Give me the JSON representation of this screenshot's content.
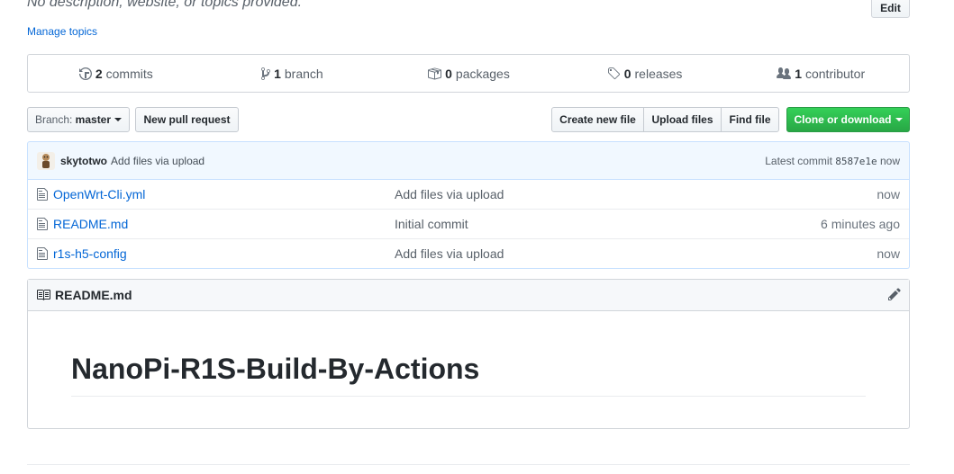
{
  "repo": {
    "description": "No description, website, or topics provided.",
    "edit_label": "Edit",
    "manage_topics": "Manage topics"
  },
  "summary": {
    "commits_count": "2",
    "commits_label": "commits",
    "branch_count": "1",
    "branch_label": "branch",
    "packages_count": "0",
    "packages_label": "packages",
    "releases_count": "0",
    "releases_label": "releases",
    "contributor_count": "1",
    "contributor_label": "contributor"
  },
  "toolbar": {
    "branch_prefix": "Branch:",
    "branch_name": "master",
    "new_pull_request": "New pull request",
    "create_new_file": "Create new file",
    "upload_files": "Upload files",
    "find_file": "Find file",
    "clone_or_download": "Clone or download",
    "clone_color": "#28a745"
  },
  "latest_commit": {
    "author": "skytotwo",
    "message": "Add files via upload",
    "prefix": "Latest commit",
    "sha": "8587e1e",
    "age": "now"
  },
  "files": [
    {
      "name": "OpenWrt-Cli.yml",
      "message": "Add files via upload",
      "age": "now",
      "icon": "file-icon"
    },
    {
      "name": "README.md",
      "message": "Initial commit",
      "age": "6 minutes ago",
      "icon": "file-icon"
    },
    {
      "name": "r1s-h5-config",
      "message": "Add files via upload",
      "age": "now",
      "icon": "file-icon"
    }
  ],
  "readme": {
    "filename": "README.md",
    "heading": "NanoPi-R1S-Build-By-Actions"
  }
}
